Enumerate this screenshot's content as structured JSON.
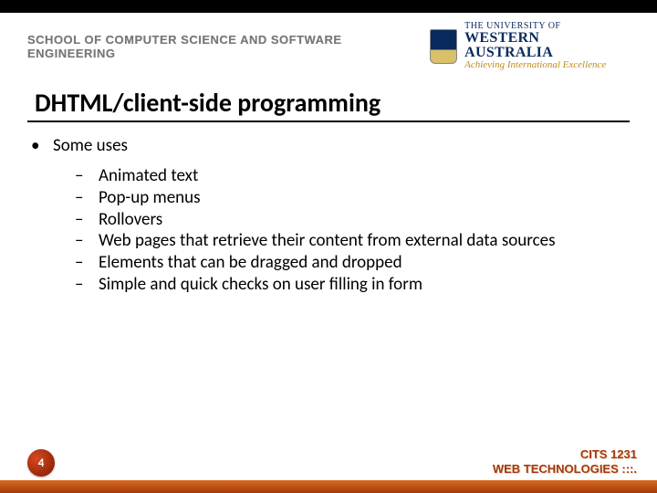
{
  "header": {
    "school": "SCHOOL OF COMPUTER SCIENCE AND SOFTWARE ENGINEERING",
    "uni_line1": "THE UNIVERSITY OF",
    "uni_line2": "WESTERN AUSTRALIA",
    "uni_line3": "Achieving International Excellence"
  },
  "title": "DHTML/client-side programming",
  "main_bullet": "Some uses",
  "sub_items": [
    "Animated text",
    "Pop-up menus",
    "Rollovers",
    "Web pages that retrieve their content from external data sources",
    "Elements that can be dragged and dropped",
    "Simple and quick checks on user filling in form"
  ],
  "footer": {
    "slide_number": "4",
    "course_line1": "CITS 1231",
    "course_line2": "WEB TECHNOLOGIES :::."
  }
}
